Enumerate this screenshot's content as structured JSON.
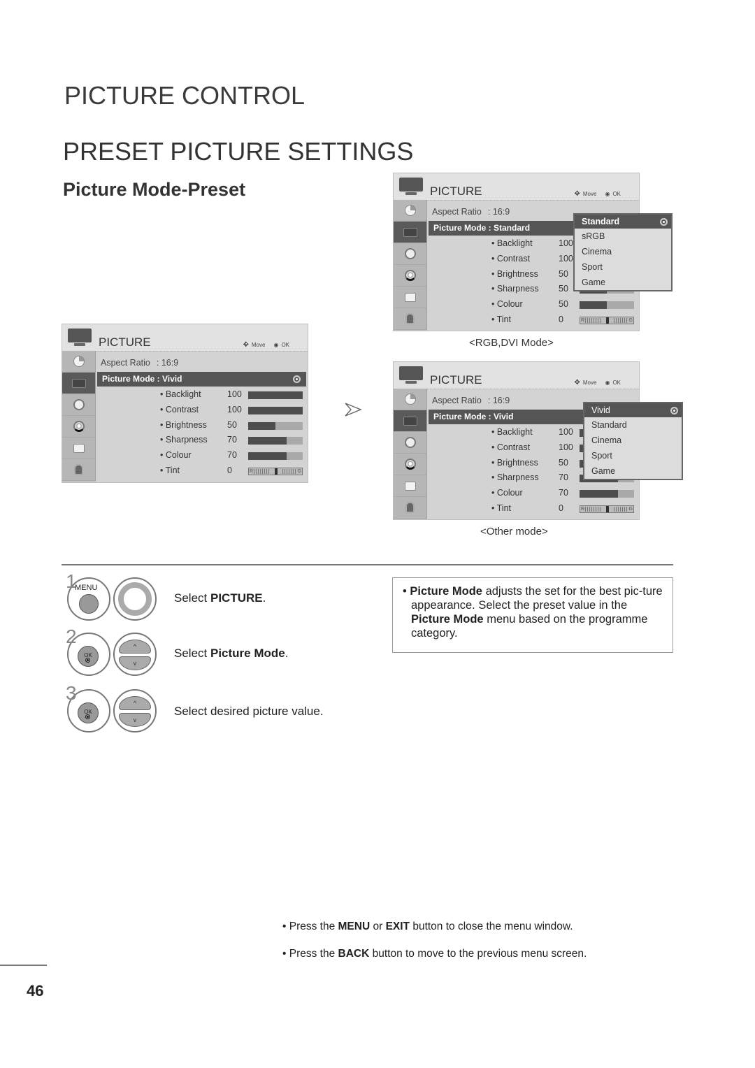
{
  "header": {
    "section": "PICTURE CONTROL",
    "title": "PRESET PICTURE SETTINGS",
    "subtitle": "Picture Mode-Preset"
  },
  "osd_common": {
    "title": "PICTURE",
    "move_hint": "Move",
    "ok_hint": "OK",
    "aspect_ratio_label": "Aspect Ratio",
    "aspect_ratio_value": ": 16:9",
    "sidebar_icons": [
      "picture-preset-icon",
      "tv-screen-icon",
      "audio-speaker-icon",
      "clock-icon",
      "option-icon",
      "lock-icon"
    ],
    "tint_left": "R",
    "tint_right": "G"
  },
  "menu_left": {
    "mode_text": "Picture Mode : Vivid",
    "settings": [
      {
        "label": "• Backlight",
        "value": "100",
        "fraction": 1.0
      },
      {
        "label": "• Contrast",
        "value": "100",
        "fraction": 1.0
      },
      {
        "label": "• Brightness",
        "value": "50",
        "fraction": 0.5
      },
      {
        "label": "• Sharpness",
        "value": "70",
        "fraction": 0.7
      },
      {
        "label": "• Colour",
        "value": "70",
        "fraction": 0.7
      },
      {
        "label": "• Tint",
        "value": "0",
        "type": "tint"
      }
    ]
  },
  "menu_rgb": {
    "mode_text": "Picture Mode : Standard",
    "caption": "<RGB,DVI Mode>",
    "settings": [
      {
        "label": "• Backlight",
        "value": "100",
        "fraction": 1.0
      },
      {
        "label": "• Contrast",
        "value": "100",
        "fraction": 1.0
      },
      {
        "label": "• Brightness",
        "value": "50",
        "fraction": 0.5
      },
      {
        "label": "• Sharpness",
        "value": "50",
        "fraction": 0.5
      },
      {
        "label": "• Colour",
        "value": "50",
        "fraction": 0.5
      },
      {
        "label": "• Tint",
        "value": "0",
        "type": "tint"
      }
    ],
    "dropdown": [
      "Standard",
      "sRGB",
      "Cinema",
      "Sport",
      "Game"
    ],
    "dropdown_selected": "Standard"
  },
  "menu_other": {
    "mode_text": "Picture Mode : Vivid",
    "caption": "<Other mode>",
    "settings": [
      {
        "label": "• Backlight",
        "value": "100",
        "fraction": 1.0
      },
      {
        "label": "• Contrast",
        "value": "100",
        "fraction": 1.0
      },
      {
        "label": "• Brightness",
        "value": "50",
        "fraction": 0.5
      },
      {
        "label": "• Sharpness",
        "value": "70",
        "fraction": 0.7
      },
      {
        "label": "• Colour",
        "value": "70",
        "fraction": 0.7
      },
      {
        "label": "• Tint",
        "value": "0",
        "type": "tint"
      }
    ],
    "dropdown": [
      "Vivid",
      "Standard",
      "Cinema",
      "Sport",
      "Game"
    ],
    "dropdown_selected": "Vivid"
  },
  "steps": [
    {
      "number": "1",
      "button": "MENU",
      "pre": "Select ",
      "bold": "PICTURE",
      "post": "."
    },
    {
      "number": "2",
      "button": "OK",
      "pre": "Select ",
      "bold": "Picture Mode",
      "post": "."
    },
    {
      "number": "3",
      "button": "OK",
      "pre": "Select desired picture value.",
      "bold": "",
      "post": ""
    }
  ],
  "note": {
    "bullet": "• ",
    "bold1": "Picture Mode",
    "text1": " adjusts the set for the best pic-ture appearance. Select the preset value in the ",
    "bold2": "Picture Mode",
    "text2": " menu based on the programme category."
  },
  "footer": [
    {
      "pre": "• Press the ",
      "b1": "MENU",
      "mid": " or ",
      "b2": "EXIT",
      "post": " button to close the menu window."
    },
    {
      "pre": "• Press the ",
      "b1": "BACK",
      "mid": "",
      "b2": "",
      "post": " button to move to the previous menu screen."
    }
  ],
  "page_number": "46"
}
